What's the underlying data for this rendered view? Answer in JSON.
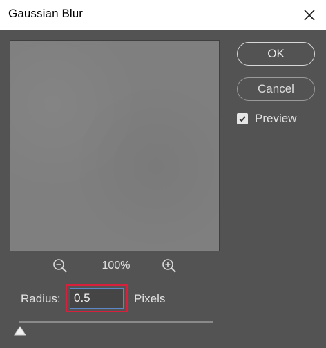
{
  "dialog": {
    "title": "Gaussian Blur",
    "close_icon": "close-icon"
  },
  "buttons": {
    "ok_label": "OK",
    "cancel_label": "Cancel"
  },
  "preview_option": {
    "label": "Preview",
    "checked": true
  },
  "zoom": {
    "level": "100%",
    "zoom_out_icon": "zoom-out-icon",
    "zoom_in_icon": "zoom-in-icon"
  },
  "radius": {
    "label": "Radius:",
    "value": "0.5",
    "unit": "Pixels",
    "slider_position": 0.005
  },
  "colors": {
    "background": "#535353",
    "highlight": "#d7213c",
    "input_focus": "#5b87c8"
  }
}
